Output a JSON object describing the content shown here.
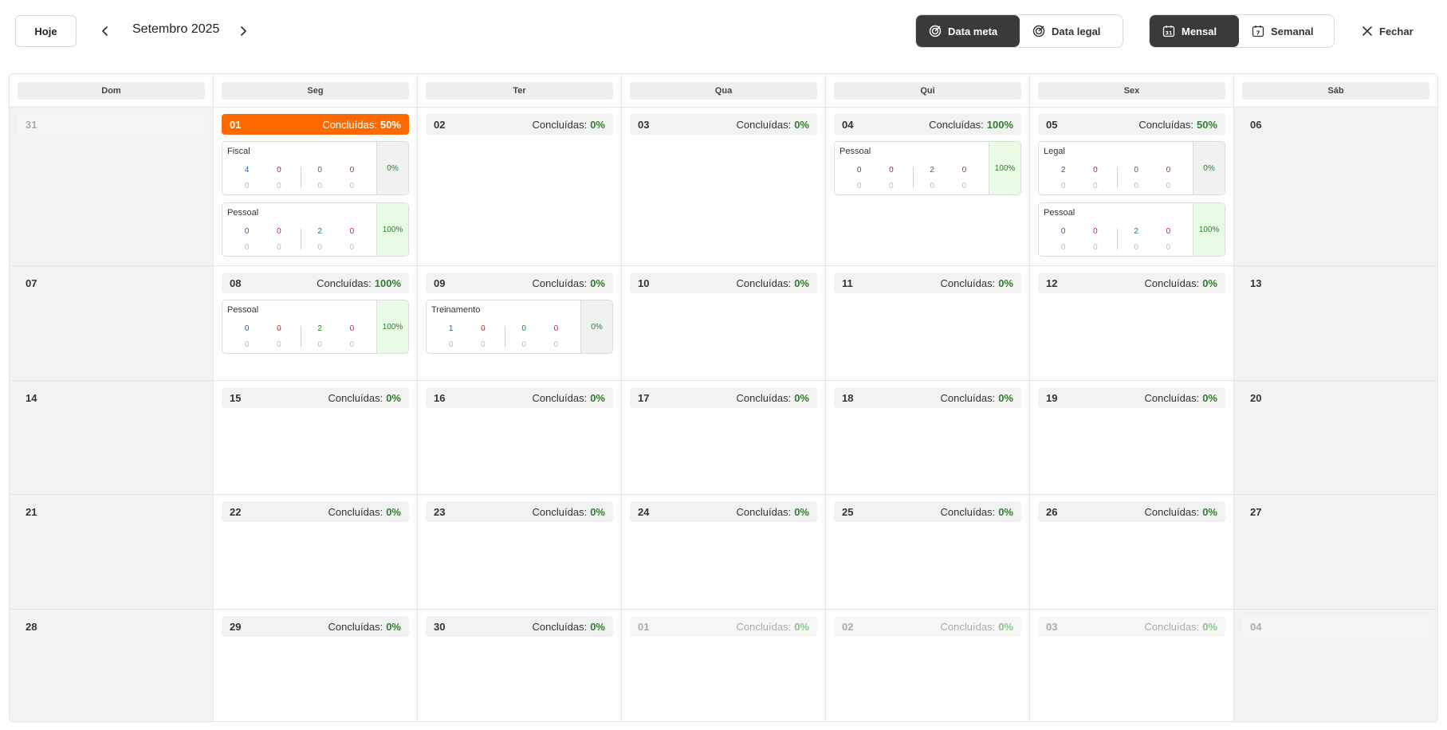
{
  "toolbar": {
    "today_label": "Hoje",
    "month_label": "Setembro 2025",
    "date_mode": [
      {
        "label": "Data meta",
        "active": true
      },
      {
        "label": "Data legal",
        "active": false
      }
    ],
    "view_mode": [
      {
        "label": "Mensal",
        "active": true,
        "icon": "calendar-31-icon"
      },
      {
        "label": "Semanal",
        "active": false,
        "icon": "calendar-7-icon"
      }
    ],
    "close_label": "Fechar"
  },
  "weekdays": [
    "Dom",
    "Seg",
    "Ter",
    "Qua",
    "Qui",
    "Sex",
    "Sáb"
  ],
  "status_label": "Concluídas:",
  "colors": {
    "accent": "#ff6a00",
    "dark": "#3a3a3a",
    "success": "#2e7d32",
    "danger": "#c62828",
    "info": "#1e5fa8"
  },
  "weeks": [
    [
      {
        "day": "31",
        "faded": true
      },
      {
        "day": "01",
        "pct": "50%",
        "today": true,
        "cards": [
          {
            "title": "Fiscal",
            "pct": "0%",
            "top": [
              "4",
              "0",
              "0",
              "0"
            ],
            "bottom": [
              "0",
              "0",
              "0",
              "0"
            ]
          },
          {
            "title": "Pessoal",
            "pct": "100%",
            "top": [
              "0",
              "0",
              "2",
              "0"
            ],
            "bottom": [
              "0",
              "0",
              "0",
              "0"
            ]
          }
        ]
      },
      {
        "day": "02",
        "pct": "0%"
      },
      {
        "day": "03",
        "pct": "0%"
      },
      {
        "day": "04",
        "pct": "100%",
        "cards": [
          {
            "title": "Pessoal",
            "pct": "100%",
            "top": [
              "0",
              "0",
              "2",
              "0"
            ],
            "bottom": [
              "0",
              "0",
              "0",
              "0"
            ]
          }
        ]
      },
      {
        "day": "05",
        "pct": "50%",
        "cards": [
          {
            "title": "Legal",
            "pct": "0%",
            "top": [
              "2",
              "0",
              "0",
              "0"
            ],
            "bottom": [
              "0",
              "0",
              "0",
              "0"
            ]
          },
          {
            "title": "Pessoal",
            "pct": "100%",
            "top": [
              "0",
              "0",
              "2",
              "0"
            ],
            "bottom": [
              "0",
              "0",
              "0",
              "0"
            ]
          }
        ]
      },
      {
        "day": "06"
      }
    ],
    [
      {
        "day": "07"
      },
      {
        "day": "08",
        "pct": "100%",
        "cards": [
          {
            "title": "Pessoal",
            "pct": "100%",
            "top": [
              "0",
              "0",
              "2",
              "0"
            ],
            "bottom": [
              "0",
              "0",
              "0",
              "0"
            ]
          }
        ]
      },
      {
        "day": "09",
        "pct": "0%",
        "cards": [
          {
            "title": "Treinamento",
            "pct": "0%",
            "top": [
              "1",
              "0",
              "0",
              "0"
            ],
            "bottom": [
              "0",
              "0",
              "0",
              "0"
            ]
          }
        ]
      },
      {
        "day": "10",
        "pct": "0%"
      },
      {
        "day": "11",
        "pct": "0%"
      },
      {
        "day": "12",
        "pct": "0%"
      },
      {
        "day": "13"
      }
    ],
    [
      {
        "day": "14"
      },
      {
        "day": "15",
        "pct": "0%"
      },
      {
        "day": "16",
        "pct": "0%"
      },
      {
        "day": "17",
        "pct": "0%"
      },
      {
        "day": "18",
        "pct": "0%"
      },
      {
        "day": "19",
        "pct": "0%"
      },
      {
        "day": "20"
      }
    ],
    [
      {
        "day": "21"
      },
      {
        "day": "22",
        "pct": "0%"
      },
      {
        "day": "23",
        "pct": "0%"
      },
      {
        "day": "24",
        "pct": "0%"
      },
      {
        "day": "25",
        "pct": "0%"
      },
      {
        "day": "26",
        "pct": "0%"
      },
      {
        "day": "27"
      }
    ],
    [
      {
        "day": "28"
      },
      {
        "day": "29",
        "pct": "0%"
      },
      {
        "day": "30",
        "pct": "0%"
      },
      {
        "day": "01",
        "pct": "0%",
        "faded": true
      },
      {
        "day": "02",
        "pct": "0%",
        "faded": true
      },
      {
        "day": "03",
        "pct": "0%",
        "faded": true
      },
      {
        "day": "04",
        "faded": true
      }
    ]
  ]
}
